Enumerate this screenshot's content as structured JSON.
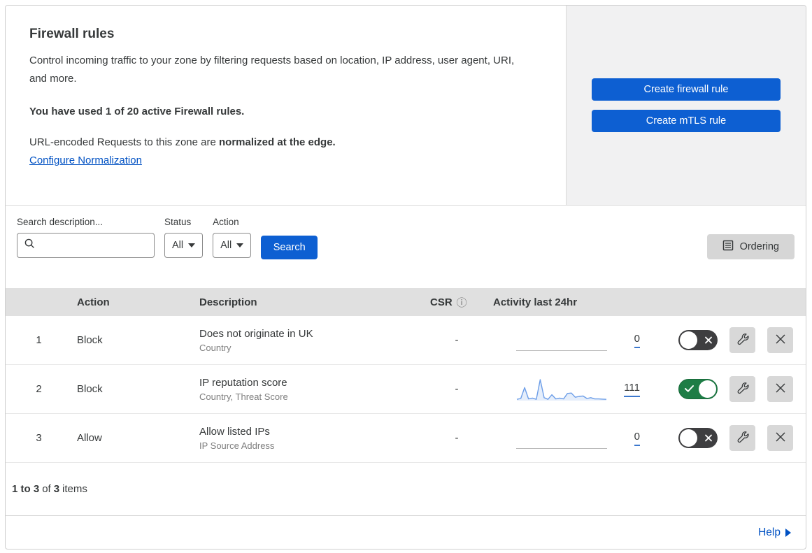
{
  "colors": {
    "accent_button_blue": "#0d5fd2",
    "link_blue": "#0051c3",
    "toggle_on_green": "#1e7d46",
    "toggle_off_gray": "#3e3e40",
    "header_band_gray": "#e0e0e0",
    "side_panel_gray": "#f1f1f2",
    "sparkline_blue": "#6d9ee8"
  },
  "header": {
    "title": "Firewall rules",
    "description": "Control incoming traffic to your zone by filtering requests based on location, IP address, user agent, URI, and more.",
    "usage_line": "You have used 1 of 20 active Firewall rules.",
    "normalization_prefix": "URL-encoded Requests to this zone are ",
    "normalization_bold": "normalized at the edge.",
    "normalization_link": "Configure Normalization",
    "create_firewall_button": "Create firewall rule",
    "create_mtls_button": "Create mTLS rule"
  },
  "filters": {
    "search_label": "Search description...",
    "search_value": "",
    "status_label": "Status",
    "status_value": "All",
    "action_label": "Action",
    "action_value": "All",
    "search_button": "Search",
    "ordering_button": "Ordering"
  },
  "table": {
    "columns": {
      "action": "Action",
      "description": "Description",
      "csr": "CSR",
      "csr_info_icon": "ⓘ",
      "activity": "Activity last 24hr"
    },
    "rows": [
      {
        "priority": "1",
        "action": "Block",
        "description": "Does not originate in UK",
        "fields": "Country",
        "csr": "-",
        "activity_count": "0",
        "activity_series": null,
        "enabled": false
      },
      {
        "priority": "2",
        "action": "Block",
        "description": "IP reputation score",
        "fields": "Country, Threat Score",
        "csr": "-",
        "activity_count": "111",
        "activity_series": [
          6,
          10,
          62,
          8,
          12,
          6,
          100,
          14,
          6,
          28,
          8,
          12,
          8,
          34,
          36,
          16,
          20,
          22,
          10,
          14,
          8,
          8,
          7,
          6
        ],
        "enabled": true
      },
      {
        "priority": "3",
        "action": "Allow",
        "description": "Allow listed IPs",
        "fields": "IP Source Address",
        "csr": "-",
        "activity_count": "0",
        "activity_series": null,
        "enabled": false
      }
    ]
  },
  "footer": {
    "range_bold": "1 to 3",
    "of_text": "of",
    "total_bold": "3",
    "items_text": "items",
    "help_label": "Help"
  }
}
